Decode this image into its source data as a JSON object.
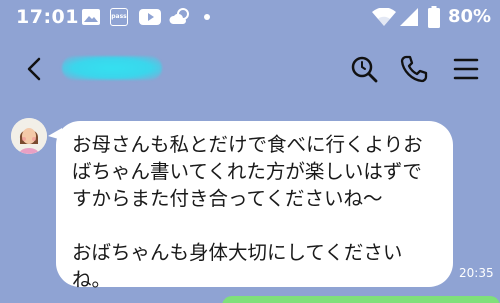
{
  "status_bar": {
    "time": "17:01",
    "badge": "pass",
    "battery": "80%",
    "icons": [
      "image-icon",
      "pass-icon",
      "youtube-icon",
      "weather-icon",
      "notification-dot-icon",
      "wifi-icon",
      "signal-icon",
      "battery-icon"
    ]
  },
  "header": {
    "icons": [
      "back-icon",
      "search-icon",
      "phone-icon",
      "menu-icon"
    ]
  },
  "message": {
    "text": "お母さんも私とだけで食べに行くよりお\nばちゃん書いてくれた方が楽しいはずで\nすからまた付き合ってくださいね〜\n\nおばちゃんも身体大切にしてください\nね。",
    "time": "20:35"
  },
  "colors": {
    "background": "#8fa3d3",
    "bubble": "#ffffff",
    "sent_bubble": "#7fe07a",
    "redaction": "#35e0f0"
  }
}
